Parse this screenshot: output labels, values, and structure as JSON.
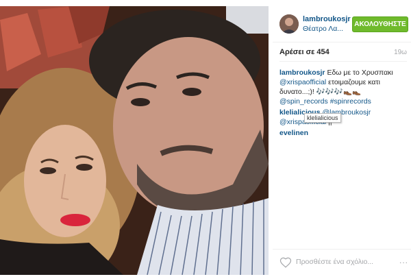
{
  "post": {
    "username": "lambroukosjr",
    "location": "Θέατρο Λα...",
    "follow_label": "ΑΚΟΛΟΥΘΗΣΤΕ",
    "likes": "Αρέσει σε 454",
    "time": "19ω",
    "caption_user": "lambroukosjr",
    "caption_text_1": " Εδω με το Χρυσπακι ",
    "caption_mention_1": "@xrispaofficial",
    "caption_text_2": " ετοιμαζουμε κατι δυνατο...;)! 🎶🎶🎶👞👞 ",
    "caption_mention_2": "@spin_records",
    "caption_space": " ",
    "caption_hashtag": "#spinrecords",
    "comment1_user": "klelialicious",
    "comment1_text_1": " ",
    "comment1_mention_1": "@lambroukosjr",
    "comment1_text_2": " ",
    "comment1_mention_2": "@xrispaofficial",
    "comment1_text_3": " ||",
    "comment2_user": "evelinen",
    "tooltip": "klelialicious",
    "add_comment_placeholder": "Προσθέστε ένα σχόλιο...",
    "more_label": "..."
  },
  "colors": {
    "link": "#125688",
    "follow_green": "#6fba2c"
  }
}
